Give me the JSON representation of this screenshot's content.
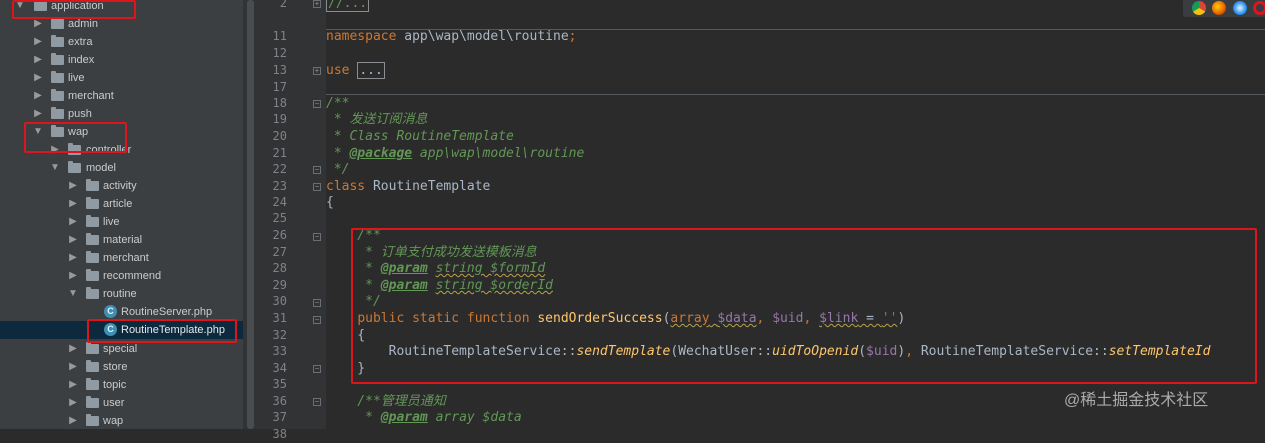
{
  "project_tree": {
    "items": [
      {
        "label": "application",
        "kind": "folder",
        "expanded": true
      },
      {
        "label": "admin",
        "kind": "folder",
        "expanded": false
      },
      {
        "label": "extra",
        "kind": "folder",
        "expanded": false
      },
      {
        "label": "index",
        "kind": "folder",
        "expanded": false
      },
      {
        "label": "live",
        "kind": "folder",
        "expanded": false
      },
      {
        "label": "merchant",
        "kind": "folder",
        "expanded": false
      },
      {
        "label": "push",
        "kind": "folder",
        "expanded": false
      },
      {
        "label": "wap",
        "kind": "folder",
        "expanded": true
      },
      {
        "label": "controller",
        "kind": "folder",
        "expanded": false
      },
      {
        "label": "model",
        "kind": "folder",
        "expanded": true
      },
      {
        "label": "activity",
        "kind": "folder",
        "expanded": false
      },
      {
        "label": "article",
        "kind": "folder",
        "expanded": false
      },
      {
        "label": "live",
        "kind": "folder",
        "expanded": false
      },
      {
        "label": "material",
        "kind": "folder",
        "expanded": false
      },
      {
        "label": "merchant",
        "kind": "folder",
        "expanded": false
      },
      {
        "label": "recommend",
        "kind": "folder",
        "expanded": false
      },
      {
        "label": "routine",
        "kind": "folder",
        "expanded": true
      },
      {
        "label": "RoutineServer.php",
        "kind": "php-class"
      },
      {
        "label": "RoutineTemplate.php",
        "kind": "php-class",
        "selected": true
      },
      {
        "label": "special",
        "kind": "folder",
        "expanded": false
      },
      {
        "label": "store",
        "kind": "folder",
        "expanded": false
      },
      {
        "label": "topic",
        "kind": "folder",
        "expanded": false
      },
      {
        "label": "user",
        "kind": "folder",
        "expanded": false
      },
      {
        "label": "wap",
        "kind": "folder",
        "expanded": false
      }
    ]
  },
  "editor": {
    "lines": [
      {
        "num": "2",
        "code": "//..."
      },
      {
        "num": "11",
        "code": "namespace app\\wap\\model\\routine;"
      },
      {
        "num": "12",
        "code": ""
      },
      {
        "num": "13",
        "code": "use ..."
      },
      {
        "num": "17",
        "code": ""
      },
      {
        "num": "18",
        "code": ""
      },
      {
        "num": "19",
        "code": "/**"
      },
      {
        "num": "20",
        "code": " * 发送订阅消息"
      },
      {
        "num": "21",
        "code": " * Class RoutineTemplate"
      },
      {
        "num": "22",
        "code": " * @package app\\wap\\model\\routine"
      },
      {
        "num": "23",
        "code": " */"
      },
      {
        "num": "24",
        "code": "class RoutineTemplate"
      },
      {
        "num": "25",
        "code": "{"
      },
      {
        "num": "26",
        "code": ""
      },
      {
        "num": "27",
        "code": "    /**"
      },
      {
        "num": "28",
        "code": "     * 订单支付成功发送模板消息"
      },
      {
        "num": "29",
        "code": "     * @param string $formId"
      },
      {
        "num": "30",
        "code": "     * @param string $orderId"
      },
      {
        "num": "31",
        "code": "     */"
      },
      {
        "num": "32",
        "code": "    public static function sendOrderSuccess(array $data, $uid, $link = '')"
      },
      {
        "num": "33",
        "code": "    {"
      },
      {
        "num": "34",
        "code": "        RoutineTemplateService::sendTemplate(WechatUser::uidToOpenid($uid), RoutineTemplateService::setTemplateId"
      },
      {
        "num": "35",
        "code": "    }"
      },
      {
        "num": "36",
        "code": ""
      },
      {
        "num": "37",
        "code": "    /**管理员通知"
      },
      {
        "num": "38",
        "code": "     * @param array $data"
      }
    ]
  },
  "browser_icons": [
    "chrome-icon",
    "firefox-icon",
    "safari-icon",
    "opera-icon"
  ],
  "watermark": "@稀土掘金技术社区",
  "colors": {
    "keyword": "#cc7832",
    "comment": "#629755",
    "function": "#ffc66d",
    "string": "#6a8759",
    "variable": "#9876aa",
    "default_text": "#a9b7c6",
    "highlight_box": "#e0141c",
    "selection": "#0d293e"
  }
}
